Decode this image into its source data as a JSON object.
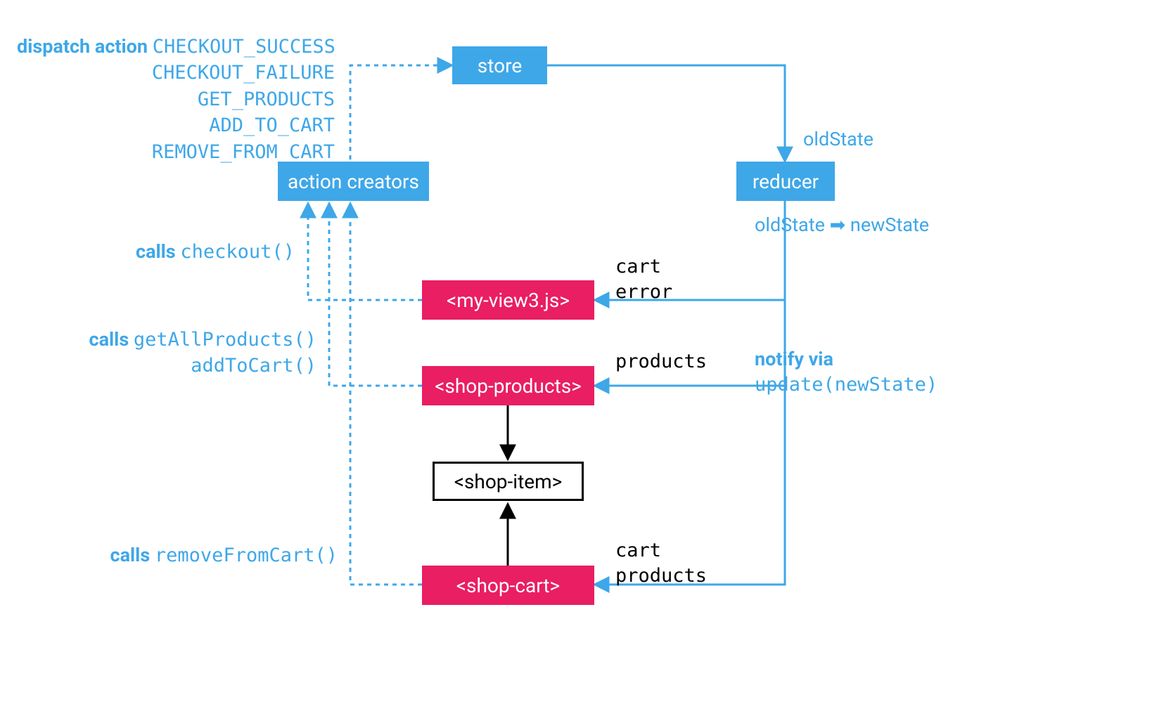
{
  "nodes": {
    "store": "store",
    "reducer": "reducer",
    "action_creators": "action creators",
    "my_view3": "<my-view3.js>",
    "shop_products": "<shop-products>",
    "shop_item": "<shop-item>",
    "shop_cart": "<shop-cart>"
  },
  "dispatch": {
    "title": "dispatch action",
    "actions": [
      "CHECKOUT_SUCCESS",
      "CHECKOUT_FAILURE",
      "GET_PRODUCTS",
      "ADD_TO_CART",
      "REMOVE_FROM_CART"
    ]
  },
  "right": {
    "old_state": "oldState",
    "state_transition": "oldState ➡ newState",
    "notify_title": "notify via",
    "notify_code": "update(newState)"
  },
  "props": {
    "my_view3": [
      "cart",
      "error"
    ],
    "shop_products": [
      "products"
    ],
    "shop_cart": [
      "cart",
      "products"
    ]
  },
  "calls": {
    "title": "calls",
    "checkout": "checkout()",
    "get_all": "getAllProducts()",
    "add": "addToCart()",
    "remove": "removeFromCart()"
  }
}
